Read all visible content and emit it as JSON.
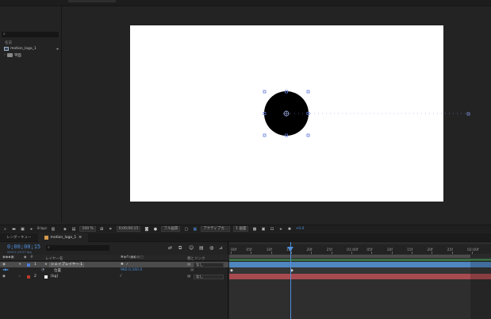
{
  "project": {
    "search_icon": "⌕",
    "column_name": "名前",
    "items": [
      {
        "name": "motion_logo_1",
        "icon": "composition-icon"
      },
      {
        "name": "平面",
        "icon": "folder-icon"
      }
    ]
  },
  "viewer_bar": {
    "bpc": "8 bpc",
    "zoom": "100 %",
    "timecode": "0;00;00;15",
    "resolution": "フル画質",
    "camera": "アクティブカ...",
    "views": "1 画面",
    "exposure": "+0.0"
  },
  "tabs": [
    {
      "label": "レンダーキュー",
      "active": false
    },
    {
      "label": "motion_logo_1",
      "active": true,
      "close": "≡"
    }
  ],
  "layer_panel": {
    "timecode": "0;00;00;15",
    "timecode_sub": "00015 (29.97 fps)",
    "search_icon": "⌕",
    "columns": {
      "layer_name": "レイヤー名",
      "parent": "親とリンク"
    },
    "layers": [
      {
        "index": "1",
        "name": "シェイプレイヤー 1",
        "label_color": "#4d7bd8",
        "parent": "なし",
        "selected": true
      },
      {
        "prop_name": "位置",
        "value": "960.0,540.0"
      },
      {
        "index": "2",
        "name": "[bg]",
        "label_color": "#c0392b",
        "parent": "なし",
        "selected": false
      }
    ]
  },
  "timeline": {
    "ticks": [
      "00f",
      "05f",
      "10f",
      "15f",
      "20f",
      "25f",
      "01:00f",
      "05f",
      "10f",
      "15f",
      "20f",
      "25f",
      "02:00f"
    ],
    "current_frame_fraction": 0.254
  },
  "colors": {
    "accent_blue": "#4d8fdc",
    "layer1_bar": "#4f86c0",
    "layer2_bar": "#a84b50",
    "track_green": "#3c6e44"
  }
}
